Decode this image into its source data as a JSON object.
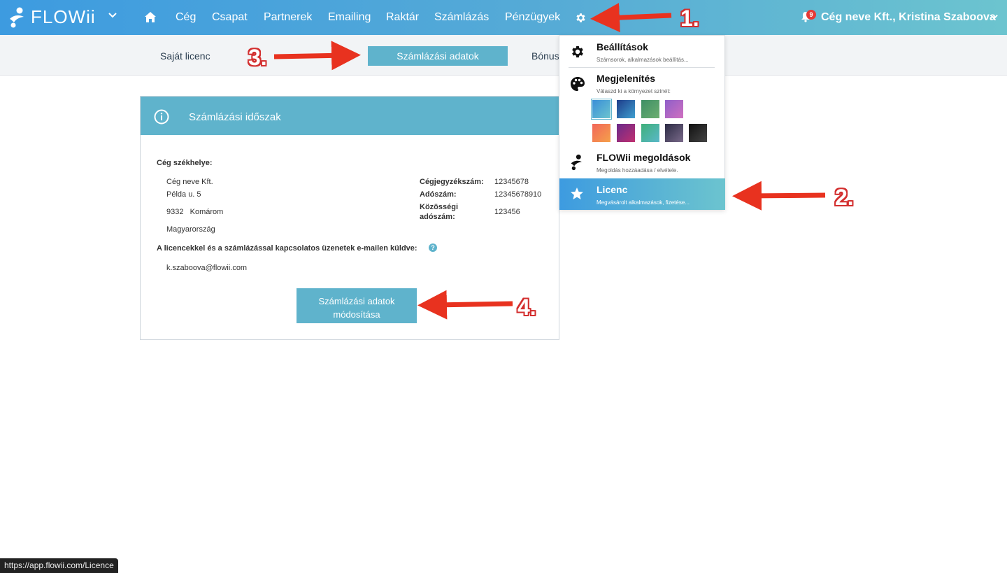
{
  "header": {
    "logo_text": "FLOWii",
    "nav": [
      "Cég",
      "Csapat",
      "Partnerek",
      "Emailing",
      "Raktár",
      "Számlázás",
      "Pénzügyek"
    ],
    "notification_count": "9",
    "user": "Cég neve Kft., Kristina Szaboova"
  },
  "subnav": {
    "tabs": [
      "Saját licenc",
      "Számlázási adatok",
      "Bónus"
    ],
    "active_index": 1
  },
  "card": {
    "title": "Számlázási időszak",
    "seat_label": "Cég székhelye:",
    "address": [
      "Cég neve Kft.",
      "Példa u. 5",
      "9332   Komárom",
      "Magyarország"
    ],
    "registry_label": "Cégjegyzékszám:",
    "registry_value": "12345678",
    "tax_label": "Adószám:",
    "tax_value": "12345678910",
    "eu_tax_label_1": "Közösségi",
    "eu_tax_label_2": "adószám:",
    "eu_tax_value": "123456",
    "email_notice": "A licencekkel és a számlázással kapcsolatos üzenetek e-mailen küldve:",
    "help": "?",
    "email": "k.szaboova@flowii.com",
    "edit_button": [
      "Számlázási adatok",
      "módosítása"
    ]
  },
  "dropdown": {
    "settings": {
      "title": "Beállítások",
      "sub": "Számsorok, alkalmazások beállítás..."
    },
    "appearance": {
      "title": "Megjelenítés",
      "sub": "Válaszd ki a környezet színét:"
    },
    "swatches": [
      [
        "#3a8fd8",
        "#6cc4cf"
      ],
      [
        "#1e3c8a",
        "#3fa0d0"
      ],
      [
        "#3f8f66",
        "#6cae70"
      ],
      [
        "#8f5fc9",
        "#d070c0"
      ],
      [
        "#f2665a",
        "#f5a14a"
      ],
      [
        "#6a2a8a",
        "#c03070"
      ],
      [
        "#3fb07a",
        "#5ab8c9"
      ],
      [
        "#2b2b44",
        "#7a6a8a"
      ],
      [
        "#111111",
        "#444444"
      ]
    ],
    "solutions": {
      "title": "FLOWii megoldások",
      "sub": "Megoldás hozzáadása / elvétele."
    },
    "licence": {
      "title": "Licenc",
      "sub": "Megvásárolt alkalmazások, fizetése..."
    }
  },
  "status_url": "https://app.flowii.com/Licence",
  "annotations": [
    "1.",
    "2.",
    "3.",
    "4."
  ]
}
